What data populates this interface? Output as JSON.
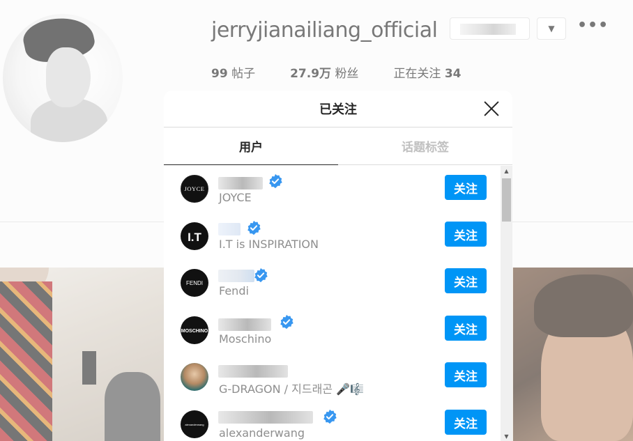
{
  "profile": {
    "username": "jerryjianailiang_official",
    "dropdown_icon": "chevron-down-icon",
    "more_icon": "more-dots-icon",
    "stats": {
      "posts_count": "99",
      "posts_label": "帖子",
      "followers_count": "27.9万",
      "followers_label": "粉丝",
      "following_label": "正在关注",
      "following_count": "34"
    }
  },
  "modal": {
    "title": "已关注",
    "close_icon": "close-icon",
    "tabs": [
      {
        "label": "用户",
        "active": true
      },
      {
        "label": "话题标签",
        "active": false
      }
    ],
    "follow_label": "关注",
    "accounts": [
      {
        "avatar_text": "JOYCE",
        "subtitle": "JOYCE",
        "verified": true
      },
      {
        "avatar_text": "I.T",
        "subtitle": "I.T is INSPIRATION",
        "verified": true
      },
      {
        "avatar_text": "FENDI",
        "subtitle": "Fendi",
        "verified": true
      },
      {
        "avatar_text": "MOSCHINO",
        "subtitle": "Moschino",
        "verified": true
      },
      {
        "avatar_text": "",
        "subtitle": "G-DRAGON / 지드래곤 🎤🎼",
        "verified": false
      },
      {
        "avatar_text": "alexanderwang",
        "subtitle": "alexanderwang",
        "verified": true
      }
    ]
  },
  "colors": {
    "follow_button": "#0095f6",
    "verified_badge": "#3897f0"
  }
}
